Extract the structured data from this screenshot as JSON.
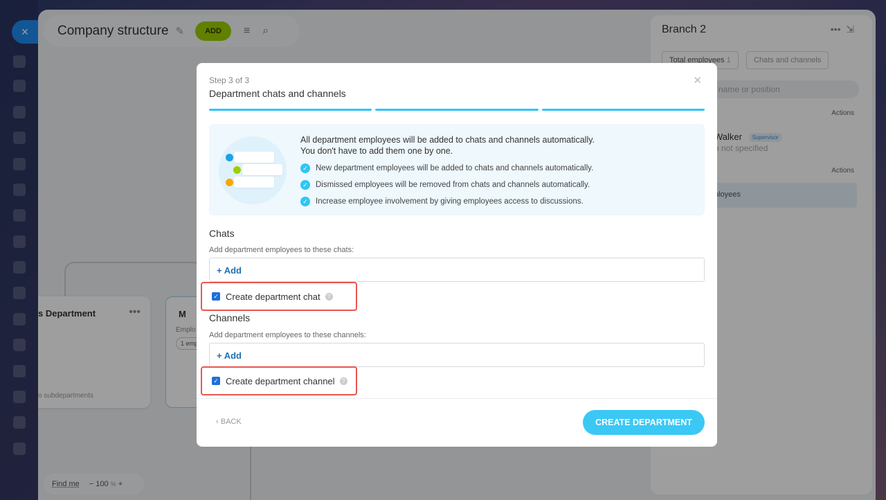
{
  "close_label": "×",
  "toolbar": {
    "title": "Company structure",
    "add_label": "ADD"
  },
  "org": {
    "dept1_name": "s Department",
    "dept1_sub": "o subdepartments",
    "dept2_name": "M",
    "dept2_emp": "Emplo",
    "dept2_chip": "1 emp"
  },
  "zoom": {
    "find_label": "Find me",
    "minus": "−",
    "value": "100",
    "unit": "%",
    "plus": "+"
  },
  "right_panel": {
    "title": "Branch 2",
    "tab_employees": "Total employees",
    "tab_employees_count": "1",
    "tab_chats": "Chats and channels",
    "search_placeholder": "name or position",
    "actions1": "Actions",
    "actions2": "Actions",
    "person_name": "Walker",
    "person_badge": "Supervisor",
    "person_position": "n not specified",
    "employees_row": "ployees"
  },
  "modal": {
    "step": "Step 3 of 3",
    "title": "Department chats and channels",
    "info_heading_1": "All department employees will be added to chats and channels automatically.",
    "info_heading_2": "You don't have to add them one by one.",
    "info_items": [
      "New department employees will be added to chats and channels automatically.",
      "Dismissed employees will be removed from chats and channels automatically.",
      "Increase employee involvement by giving employees access to discussions."
    ],
    "chats_title": "Chats",
    "chats_sub": "Add department employees to these chats:",
    "add_label": "+ Add",
    "create_chat_label": "Create department chat",
    "channels_title": "Channels",
    "channels_sub": "Add department employees to these channels:",
    "create_channel_label": "Create department channel",
    "back_label": "BACK",
    "create_label": "CREATE DEPARTMENT"
  },
  "colors": {
    "accent": "#2fc6f6",
    "highlight": "#e8564f",
    "add_button": "#9dcf00"
  }
}
